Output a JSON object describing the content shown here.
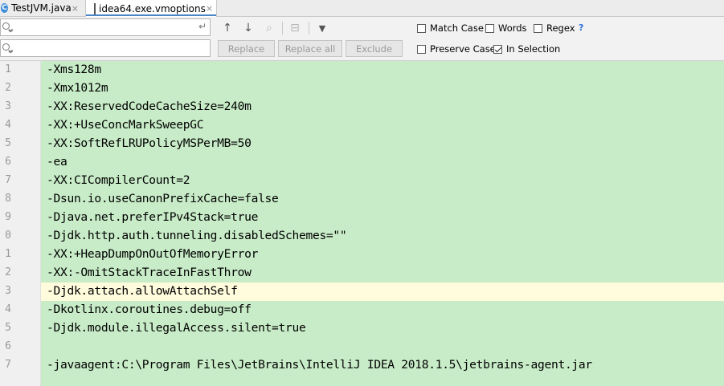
{
  "tabs": [
    {
      "label": "TestJVM.java",
      "icon": "java-class-icon",
      "close": "×"
    },
    {
      "label": "idea64.exe.vmoptions",
      "icon": "text-file-icon",
      "close": "×"
    }
  ],
  "search": {
    "find_value": "",
    "replace_value": "",
    "newline_symbol": "↵",
    "buttons": {
      "replace": "Replace",
      "replace_all": "Replace all",
      "exclude": "Exclude"
    },
    "tool_symbols": {
      "prev": "↑",
      "next": "↓",
      "find_all": "⌕",
      "select_all": "⊟",
      "filter": "▼"
    },
    "options": {
      "match_case": {
        "label": "Match Case",
        "checked": false
      },
      "words": {
        "label": "Words",
        "checked": false
      },
      "regex": {
        "label": "Regex",
        "checked": false
      },
      "regex_help": "?",
      "preserve_case": {
        "label": "Preserve Case",
        "checked": false
      },
      "in_selection": {
        "label": "In Selection",
        "checked": true
      }
    }
  },
  "editor": {
    "current_line": 13,
    "highlight_color": "#c8ecc8",
    "current_line_color": "#fefcdc",
    "lines": [
      {
        "num": "1",
        "text": "-Xms128m"
      },
      {
        "num": "2",
        "text": "-Xmx1012m"
      },
      {
        "num": "3",
        "text": "-XX:ReservedCodeCacheSize=240m"
      },
      {
        "num": "4",
        "text": "-XX:+UseConcMarkSweepGC"
      },
      {
        "num": "5",
        "text": "-XX:SoftRefLRUPolicyMSPerMB=50"
      },
      {
        "num": "6",
        "text": "-ea"
      },
      {
        "num": "7",
        "text": "-XX:CICompilerCount=2"
      },
      {
        "num": "8",
        "text": "-Dsun.io.useCanonPrefixCache=false"
      },
      {
        "num": "9",
        "text": "-Djava.net.preferIPv4Stack=true"
      },
      {
        "num": "0",
        "text": "-Djdk.http.auth.tunneling.disabledSchemes=\"\""
      },
      {
        "num": "1",
        "text": "-XX:+HeapDumpOnOutOfMemoryError"
      },
      {
        "num": "2",
        "text": "-XX:-OmitStackTraceInFastThrow"
      },
      {
        "num": "3",
        "text": "-Djdk.attach.allowAttachSelf"
      },
      {
        "num": "4",
        "text": "-Dkotlinx.coroutines.debug=off"
      },
      {
        "num": "5",
        "text": "-Djdk.module.illegalAccess.silent=true"
      },
      {
        "num": "6",
        "text": ""
      },
      {
        "num": "7",
        "text": "-javaagent:C:\\Program Files\\JetBrains\\IntelliJ IDEA 2018.1.5\\jetbrains-agent.jar"
      }
    ]
  }
}
